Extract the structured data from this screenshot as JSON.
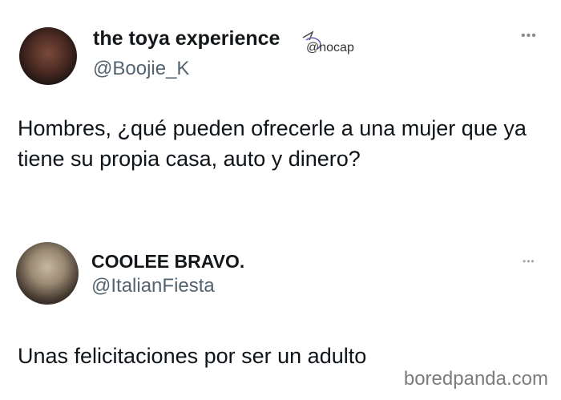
{
  "tweets": [
    {
      "display_name": "the toya experience",
      "badge_text": "@nocap",
      "handle": "@Boojie_K",
      "more": "•••",
      "text": "Hombres, ¿qué pueden ofrecerle a una mujer que ya tiene su propia casa, auto y dinero?"
    },
    {
      "display_name": "COOLEE BRAVO.",
      "handle": "@ItalianFiesta",
      "more": "•••",
      "text": "Unas felicitaciones por ser un adulto"
    }
  ],
  "watermark": "boredpanda.com",
  "icons": {
    "badge": "unicorn-icon",
    "more": "more-options-icon"
  }
}
